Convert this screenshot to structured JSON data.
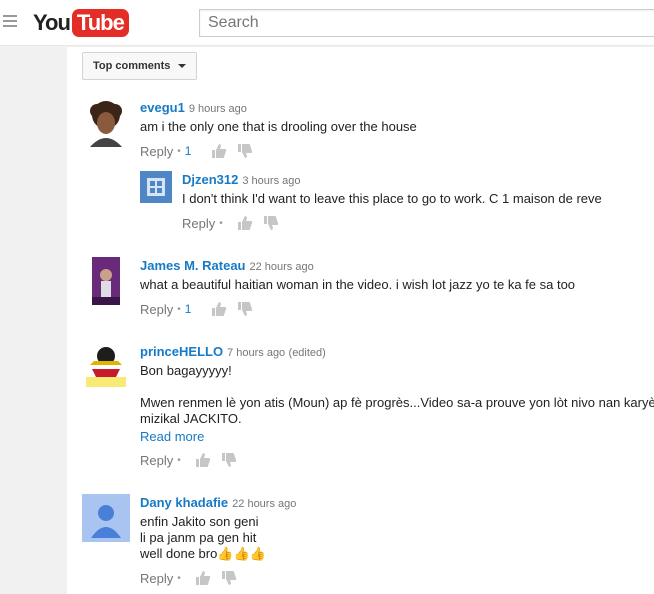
{
  "header": {
    "logo_you": "You",
    "logo_tube": "Tube",
    "search_placeholder": "Search"
  },
  "sort": {
    "label": "Top comments"
  },
  "colors": {
    "link": "#167ac6",
    "brand_red": "#e52d27"
  },
  "comments": [
    {
      "author": "evegu1",
      "time": "9 hours ago",
      "text": "am i the only one that is drooling over the house",
      "reply_label": "Reply",
      "likes": "1"
    },
    {
      "author": "Djzen312",
      "time": "3 hours ago",
      "text": "I don't think I'd want to leave this place to go to work. C 1 maison de reve",
      "reply_label": "Reply"
    },
    {
      "author": "James M. Rateau",
      "time": "22 hours ago",
      "text": "what a beautiful haitian woman in the video. i wish lot jazz yo te ka fe sa too",
      "reply_label": "Reply",
      "likes": "1"
    },
    {
      "author": "princeHELLO",
      "time": "7 hours ago",
      "edited": "(edited)",
      "text1": "Bon bagayyyyy!",
      "text2": "Mwen renmen lè yon atis (Moun) ap fè progrès...Video sa-a prouve yon lòt nivo nan karyè",
      "text3": "mizikal JACKITO.",
      "read_more": "Read more",
      "reply_label": "Reply"
    },
    {
      "author": "Dany khadafie",
      "time": "22 hours ago",
      "text1": "enfin Jakito son geni",
      "text2": "li pa janm pa gen hit",
      "text3": "well done bro👍👍👍",
      "reply_label": "Reply"
    }
  ]
}
